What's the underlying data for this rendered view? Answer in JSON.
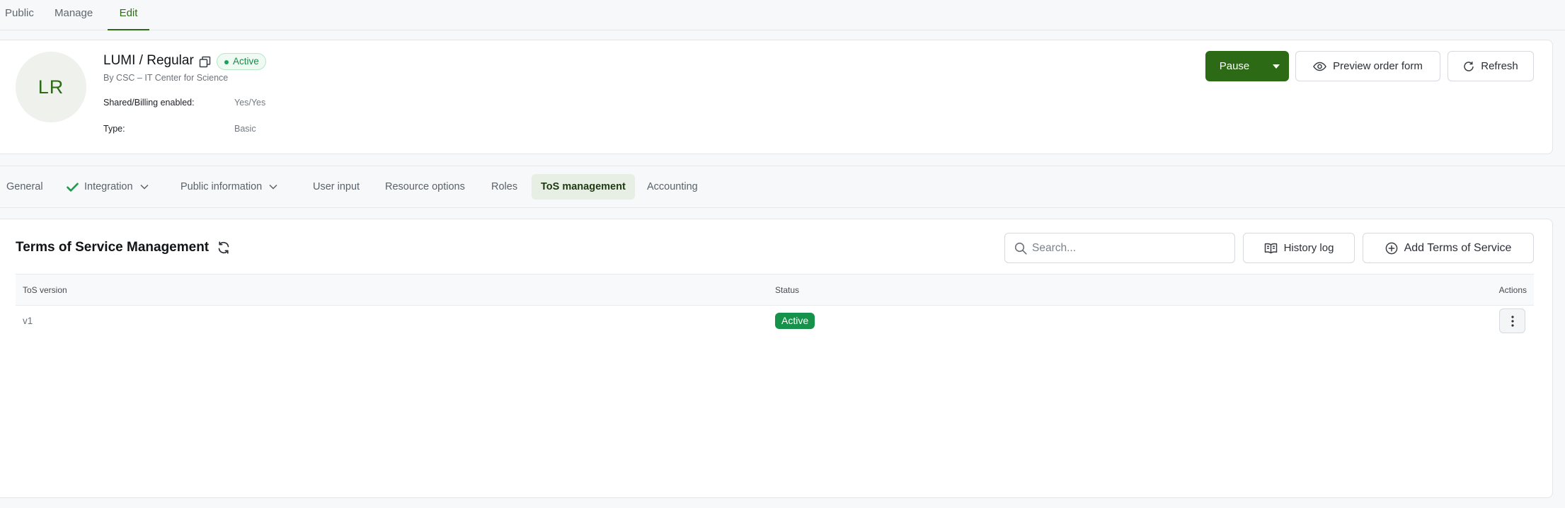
{
  "top_tabs": [
    {
      "label": "Public"
    },
    {
      "label": "Manage"
    },
    {
      "label": "Edit"
    }
  ],
  "offering": {
    "initials": "LR",
    "title": "LUMI / Regular",
    "status": "Active",
    "provider": "By CSC – IT Center for Science",
    "meta": [
      {
        "label": "Shared/Billing enabled:",
        "value": "Yes/Yes"
      },
      {
        "label": "Type:",
        "value": "Basic"
      }
    ]
  },
  "header_actions": {
    "pause": "Pause",
    "preview": "Preview order form",
    "refresh": "Refresh"
  },
  "sub_tabs": [
    {
      "label": "General"
    },
    {
      "label": "Integration"
    },
    {
      "label": "Public information"
    },
    {
      "label": "User input"
    },
    {
      "label": "Resource options"
    },
    {
      "label": "Roles"
    },
    {
      "label": "ToS management"
    },
    {
      "label": "Accounting"
    }
  ],
  "tos": {
    "title": "Terms of Service Management",
    "search_placeholder": "Search...",
    "history_button": "History log",
    "add_button": "Add Terms of Service",
    "columns": [
      "ToS version",
      "Status",
      "Actions"
    ],
    "rows": [
      {
        "version": "v1",
        "status": "Active"
      }
    ]
  },
  "colors": {
    "brand_green": "#2d6a16",
    "active_badge": "#16924a",
    "active_pill_text": "#1a8a47"
  },
  "icons": {
    "copy": "copy-icon",
    "preview": "eye-icon",
    "refresh": "refresh-icon",
    "integration": "check-icon",
    "dropdown": "chevron-down-icon",
    "search": "search-icon",
    "history": "book-icon",
    "add": "plus-circle-icon",
    "row_actions": "more-vertical-icon"
  }
}
